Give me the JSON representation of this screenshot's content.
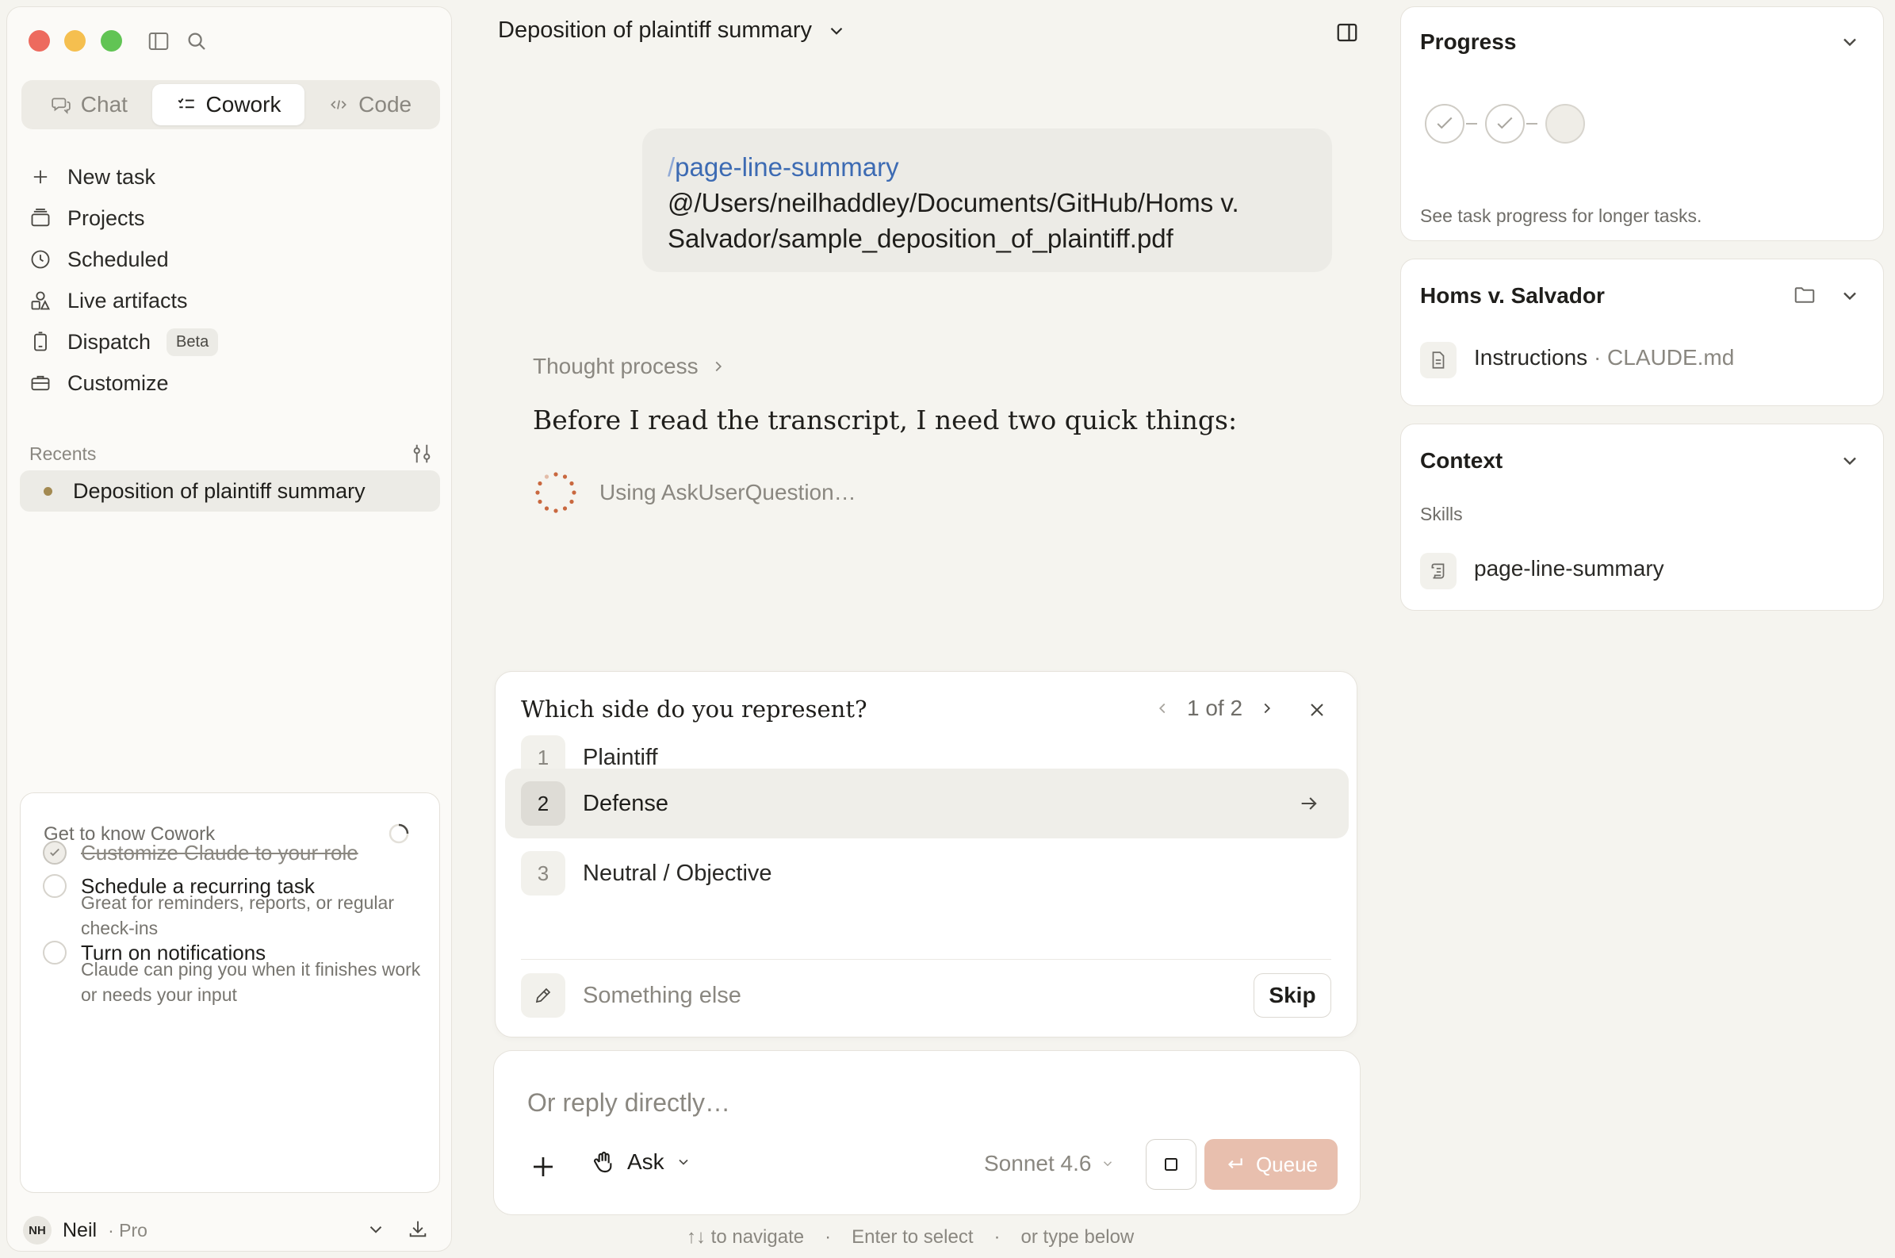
{
  "sidebar": {
    "modes": [
      {
        "label": "Chat",
        "icon": "chat-bubbles-icon"
      },
      {
        "label": "Cowork",
        "icon": "checklist-icon",
        "active": true
      },
      {
        "label": "Code",
        "icon": "code-brackets-icon"
      }
    ],
    "nav": [
      {
        "label": "New task",
        "icon": "plus-icon"
      },
      {
        "label": "Projects",
        "icon": "folder-stack-icon"
      },
      {
        "label": "Scheduled",
        "icon": "clock-icon"
      },
      {
        "label": "Live artifacts",
        "icon": "shapes-icon"
      },
      {
        "label": "Dispatch",
        "icon": "device-icon",
        "badge": "Beta"
      },
      {
        "label": "Customize",
        "icon": "briefcase-icon"
      }
    ],
    "recents_label": "Recents",
    "recents": [
      {
        "label": "Deposition of plaintiff summary"
      }
    ],
    "get_to_know": {
      "title": "Get to know Cowork",
      "items": [
        {
          "title": "Customize Claude to your role",
          "done": true,
          "desc": ""
        },
        {
          "title": "Schedule a recurring task",
          "done": false,
          "desc": "Great for reminders, reports, or regular check-ins"
        },
        {
          "title": "Turn on notifications",
          "done": false,
          "desc": "Claude can ping you when it finishes work or needs your input"
        }
      ]
    },
    "user": {
      "initials": "NH",
      "name": "Neil",
      "plan": "· Pro"
    }
  },
  "main": {
    "title": "Deposition of plaintiff summary",
    "user_message": {
      "slash": "/",
      "command": "page-line-summary",
      "path": "@/Users/neilhaddley/Documents/GitHub/Homs v. Salvador/sample_deposition_of_plaintiff.pdf"
    },
    "thought_label": "Thought process",
    "assistant_text": "Before I read the transcript, I need two quick things:",
    "tool_status": "Using AskUserQuestion…",
    "question": {
      "title": "Which side do you represent?",
      "pager": "1 of 2",
      "options": [
        {
          "num": "1",
          "label": "Plaintiff",
          "selected": false
        },
        {
          "num": "2",
          "label": "Defense",
          "selected": true
        },
        {
          "num": "3",
          "label": "Neutral / Objective",
          "selected": false
        }
      ],
      "other_placeholder": "Something else",
      "skip_label": "Skip"
    },
    "reply": {
      "placeholder": "Or reply directly…",
      "ask_label": "Ask",
      "model_label": "Sonnet 4.6",
      "queue_label": "Queue"
    },
    "hints": [
      "↑↓ to navigate",
      "·",
      "Enter to select",
      "·",
      "or type below"
    ]
  },
  "right": {
    "progress": {
      "title": "Progress",
      "steps_completed": 2,
      "steps_total": 3,
      "desc": "See task progress for longer tasks."
    },
    "project": {
      "title": "Homs v. Salvador",
      "file_label": "Instructions",
      "file_sub": " · CLAUDE.md"
    },
    "context": {
      "title": "Context",
      "skills_label": "Skills",
      "skill": "page-line-summary"
    }
  },
  "colors": {
    "accent_link": "#3d6bb3",
    "queue_button": "#e8bfae",
    "spinner": "#c9683f",
    "recent_dot": "#a38a52"
  }
}
